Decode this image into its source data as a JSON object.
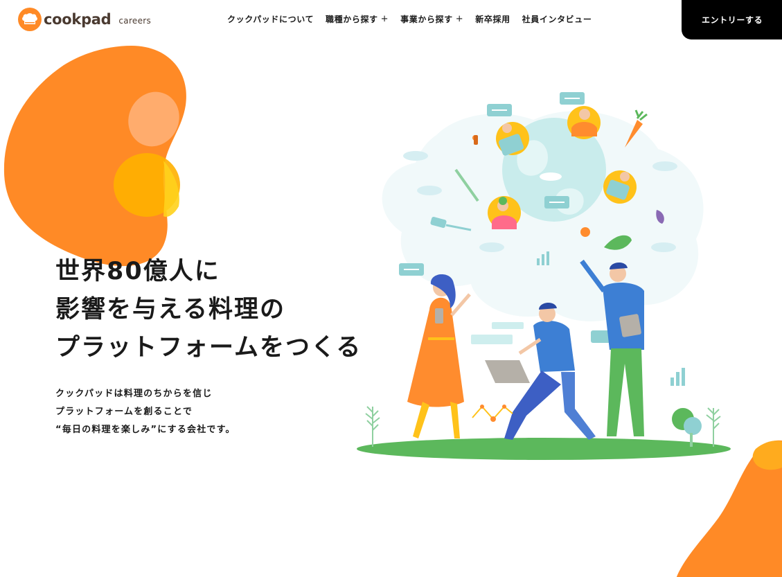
{
  "brand": {
    "name": "cookpad",
    "sub": "careers",
    "primary_color": "#ff9933"
  },
  "nav": {
    "items": [
      {
        "label": "クックパッドについて",
        "has_plus": false
      },
      {
        "label": "職種から探す",
        "has_plus": true,
        "plus": "+"
      },
      {
        "label": "事業から探す",
        "has_plus": true,
        "plus": "+"
      },
      {
        "label": "新卒採用",
        "has_plus": false
      },
      {
        "label": "社員インタビュー",
        "has_plus": false
      }
    ],
    "entry_label": "エントリーする"
  },
  "hero": {
    "lines": [
      "世界80億人に",
      "影響を与える料理の",
      "プラットフォームをつくる"
    ]
  },
  "lead": {
    "lines": [
      "クックパッドは料理のちからを信じ",
      "プラットフォームを創ることで",
      "“毎日の料理を楽しみ”にする会社です。"
    ]
  },
  "illustration": {
    "icon": "people-cooking-platform-illustration"
  },
  "colors": {
    "orange": "#ff8c2e",
    "yellow": "#ffc21a",
    "teal": "#9fdcd8",
    "green": "#5cb85c",
    "blue": "#3d6fc4"
  }
}
